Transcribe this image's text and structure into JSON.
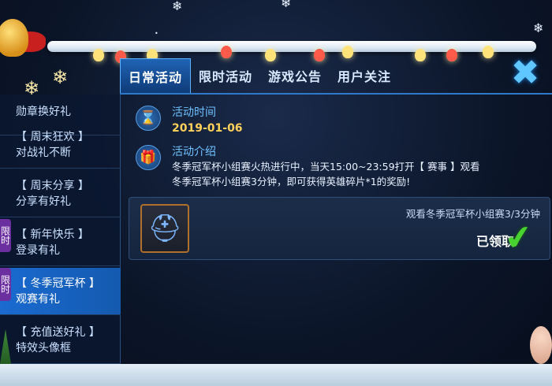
{
  "tabs": [
    {
      "label": "日常活动",
      "active": true
    },
    {
      "label": "限时活动",
      "active": false
    },
    {
      "label": "游戏公告",
      "active": false
    },
    {
      "label": "用户关注",
      "active": false
    }
  ],
  "sidebar": {
    "items": [
      {
        "title": "",
        "subtitle": "勋章换好礼",
        "badge": ""
      },
      {
        "title": "【 周末狂欢 】",
        "subtitle": "对战礼不断",
        "badge": ""
      },
      {
        "title": "【 周末分享 】",
        "subtitle": "分享有好礼",
        "badge": ""
      },
      {
        "title": "【 新年快乐 】",
        "subtitle": "登录有礼",
        "badge": "限时"
      },
      {
        "title": "【 冬季冠军杯 】",
        "subtitle": "观赛有礼",
        "badge": "限时"
      },
      {
        "title": "【 充值送好礼 】",
        "subtitle": "特效头像框",
        "badge": ""
      }
    ]
  },
  "activity": {
    "time_label": "活动时间",
    "date": "2019-01-06",
    "intro_label": "活动介绍",
    "intro_line1": "冬季冠军杯小组赛火热进行中，当天15:00~23:59打开【 赛事 】观看",
    "intro_line2": "冬季冠军杯小组赛3分钟，即可获得英雄碎片*1的奖励!"
  },
  "reward": {
    "task": "观看冬季冠军杯小组赛3/3分钟",
    "status": "已领取"
  },
  "icons": {
    "time": "hourglass-icon",
    "intro": "gift-icon",
    "close": "close-icon",
    "check": "check-icon",
    "reward": "hero-helmet-icon"
  },
  "colors": {
    "accent": "#1a6ad0",
    "date": "#ffd15a",
    "label": "#6fc1ff",
    "check": "#47d22f"
  }
}
